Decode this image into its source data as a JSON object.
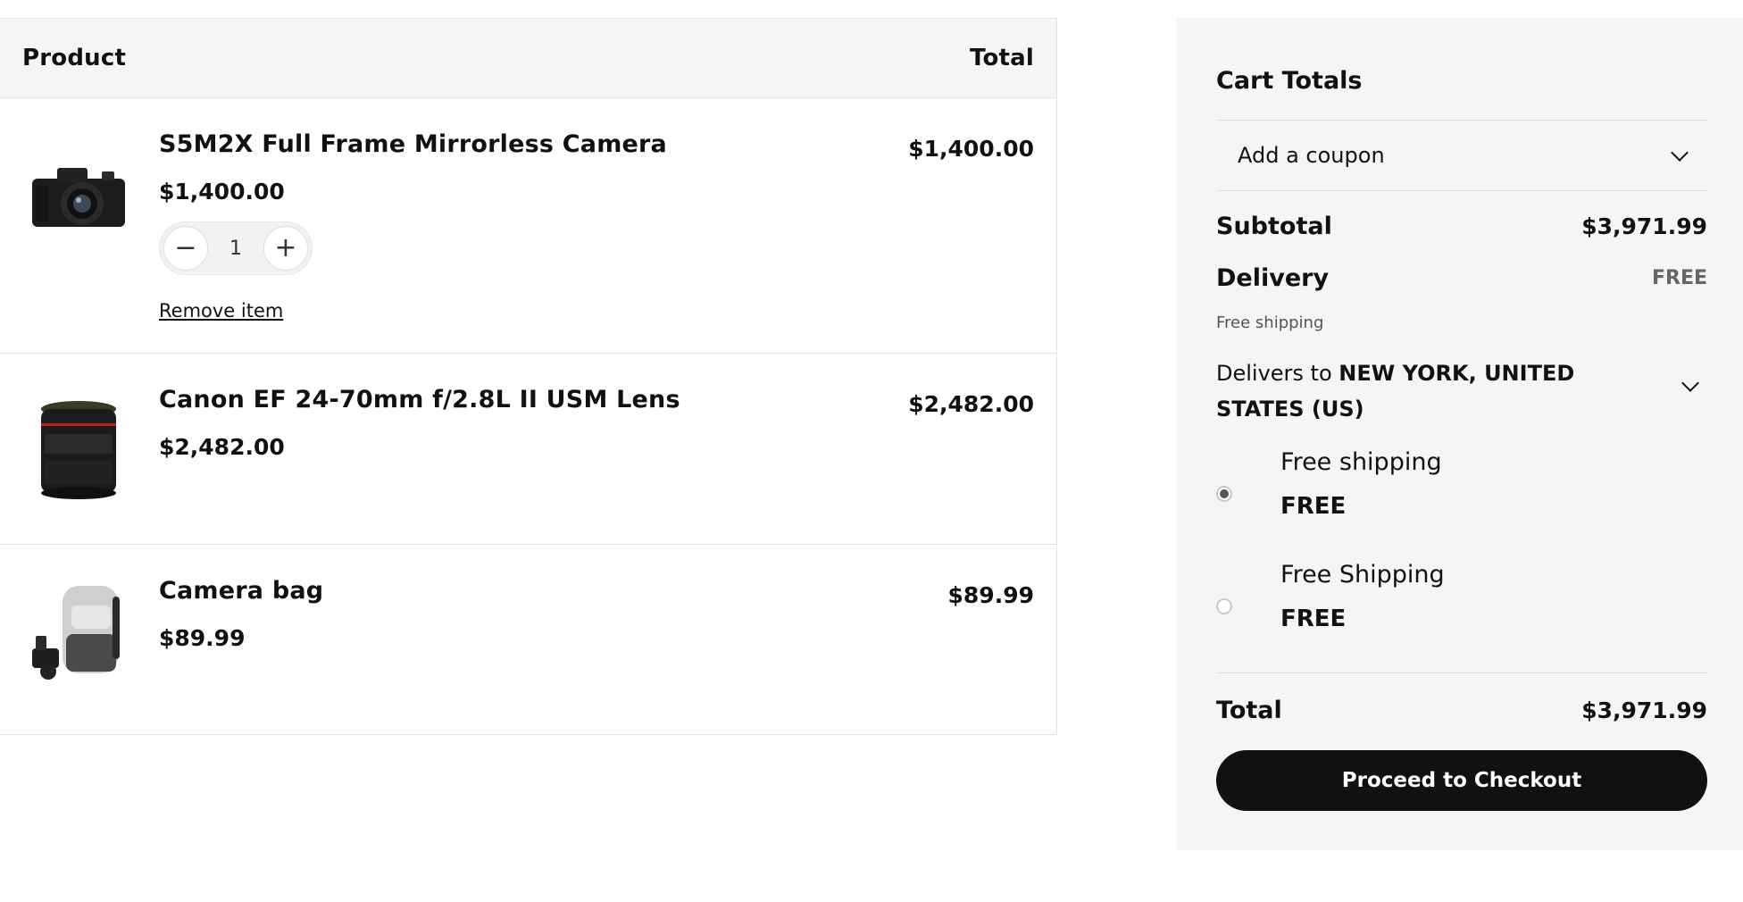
{
  "table": {
    "header_product": "Product",
    "header_total": "Total"
  },
  "items": [
    {
      "name": "S5M2X Full Frame Mirrorless Camera",
      "price": "$1,400.00",
      "total": "$1,400.00",
      "quantity": "1",
      "remove_label": "Remove item",
      "icon": "camera-icon"
    },
    {
      "name": "Canon EF 24-70mm f/2.8L II USM Lens",
      "price": "$2,482.00",
      "total": "$2,482.00",
      "icon": "lens-icon"
    },
    {
      "name": "Camera bag",
      "price": "$89.99",
      "total": "$89.99",
      "icon": "backpack-icon"
    }
  ],
  "totals": {
    "title": "Cart Totals",
    "coupon_label": "Add a coupon",
    "subtotal_label": "Subtotal",
    "subtotal_value": "$3,971.99",
    "delivery_label": "Delivery",
    "delivery_value": "FREE",
    "delivery_note": "Free shipping",
    "delivers_to_prefix": "Delivers to ",
    "delivers_to_location": "NEW YORK, UNITED STATES (US)",
    "shipping_options": [
      {
        "name": "Free shipping",
        "price": "FREE",
        "selected": true
      },
      {
        "name": "Free Shipping",
        "price": "FREE",
        "selected": false
      }
    ],
    "total_label": "Total",
    "total_value": "$3,971.99",
    "checkout_label": "Proceed to Checkout"
  },
  "colors": {
    "panel_bg": "#f5f5f5",
    "checkout_bg": "#111111",
    "border": "#e4e4e4"
  }
}
